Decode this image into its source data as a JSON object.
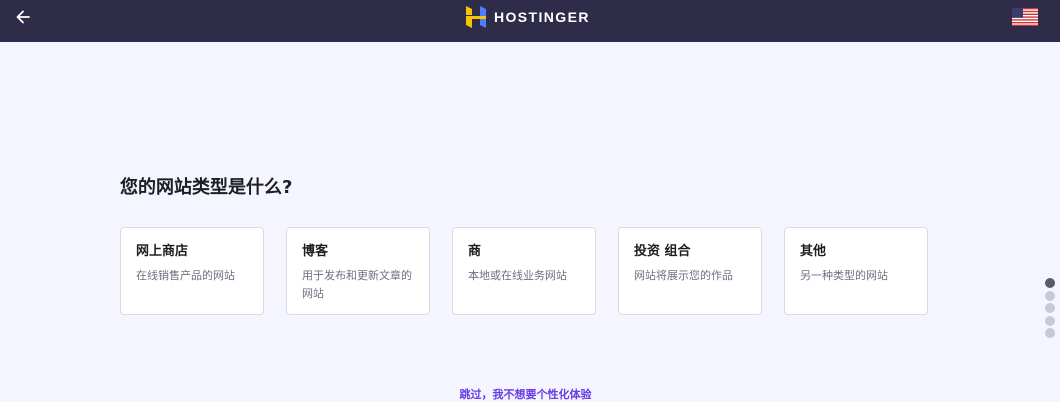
{
  "header": {
    "brand": "HOSTINGER",
    "brand_colors": {
      "bar": "#2f2c4a",
      "mark_left": "#f7c400",
      "mark_right": "#4f7cff"
    },
    "icons": {
      "back": "arrow-left-icon",
      "language": "us-flag-icon"
    }
  },
  "question": "您的网站类型是什么?",
  "options": [
    {
      "title": "网上商店",
      "description": "在线销售产品的网站"
    },
    {
      "title": "博客",
      "description": "用于发布和更新文章的网站"
    },
    {
      "title": "商",
      "description": "本地或在线业务网站"
    },
    {
      "title": "投资 组合",
      "description": "网站将展示您的作品"
    },
    {
      "title": "其他",
      "description": "另一种类型的网站"
    }
  ],
  "skip_link": "跳过，我不想要个性化体验",
  "progress": {
    "total_steps": 5,
    "current_step": 1
  },
  "colors": {
    "accent": "#673de6",
    "page_bg": "#f4f5ff"
  }
}
